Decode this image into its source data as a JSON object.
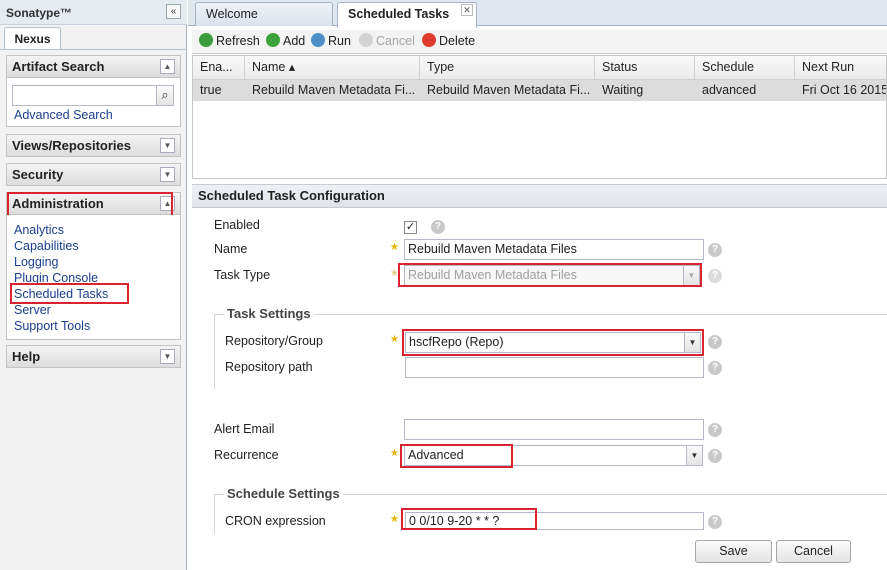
{
  "sidebar": {
    "brand": "Sonatype™",
    "collapse_glyph": "«",
    "tab": "Nexus",
    "artifact_search": {
      "title": "Artifact Search",
      "search_value": "",
      "advanced_link": "Advanced Search"
    },
    "views_repositories": "Views/Repositories",
    "security": "Security",
    "administration": {
      "title": "Administration",
      "items": [
        "Analytics",
        "Capabilities",
        "Logging",
        "Plugin Console",
        "Scheduled Tasks",
        "Server",
        "Support Tools"
      ]
    },
    "help": "Help"
  },
  "tabs": [
    {
      "label": "Welcome"
    },
    {
      "label": "Scheduled Tasks",
      "close_glyph": "✕"
    }
  ],
  "toolbar": {
    "refresh": "Refresh",
    "add": "Add",
    "run": "Run",
    "cancel": "Cancel",
    "delete": "Delete"
  },
  "grid": {
    "columns": [
      "Ena...",
      "Name ▴",
      "Type",
      "Status",
      "Schedule",
      "Next Run"
    ],
    "rows": [
      [
        "true",
        "Rebuild Maven Metadata Fi...",
        "Rebuild Maven Metadata Fi...",
        "Waiting",
        "advanced",
        "Fri Oct 16 2015"
      ]
    ]
  },
  "config": {
    "title": "Scheduled Task Configuration",
    "enabled_label": "Enabled",
    "name_label": "Name",
    "name_value": "Rebuild Maven Metadata Files",
    "task_type_label": "Task Type",
    "task_type_value": "Rebuild Maven Metadata Files",
    "task_settings_legend": "Task Settings",
    "repo_group_label": "Repository/Group",
    "repo_group_value": "hscfRepo (Repo)",
    "repo_path_label": "Repository path",
    "repo_path_value": "",
    "alert_email_label": "Alert Email",
    "alert_email_value": "",
    "recurrence_label": "Recurrence",
    "recurrence_value": "Advanced",
    "schedule_settings_legend": "Schedule Settings",
    "cron_label": "CRON expression",
    "cron_value": "0 0/10 9-20 * * ?",
    "save": "Save",
    "cancel": "Cancel"
  },
  "glyphs": {
    "help": "?",
    "check": "✓",
    "dropdown": "▼",
    "collapse_up": "▲",
    "expand_down": "▼",
    "search": "⌕"
  },
  "colors": {
    "highlight": "#d9232e",
    "link": "#1b3f8f",
    "required_star": "#e8b200"
  }
}
